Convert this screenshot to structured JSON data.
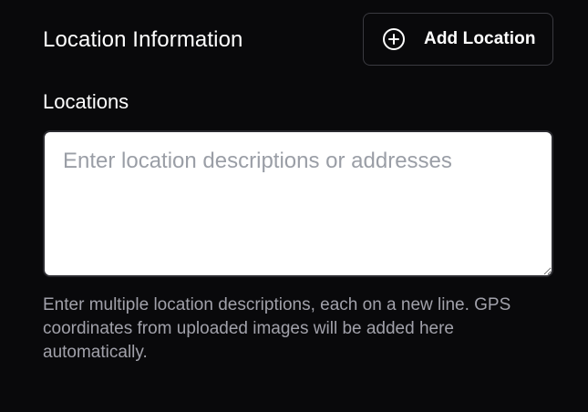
{
  "section": {
    "title": "Location Information"
  },
  "add_location_button": {
    "label": "Add Location",
    "icon": "plus-circle-icon"
  },
  "locations_field": {
    "label": "Locations",
    "value": "",
    "placeholder": "Enter location descriptions or addresses",
    "help_text": "Enter multiple location descriptions, each on a new line. GPS coordinates from uploaded images will be added here automatically."
  },
  "colors": {
    "background": "#09090b",
    "text_primary": "#ffffff",
    "text_muted": "#a1a1aa",
    "border": "#3a3a40",
    "placeholder": "#9a9ea6"
  }
}
